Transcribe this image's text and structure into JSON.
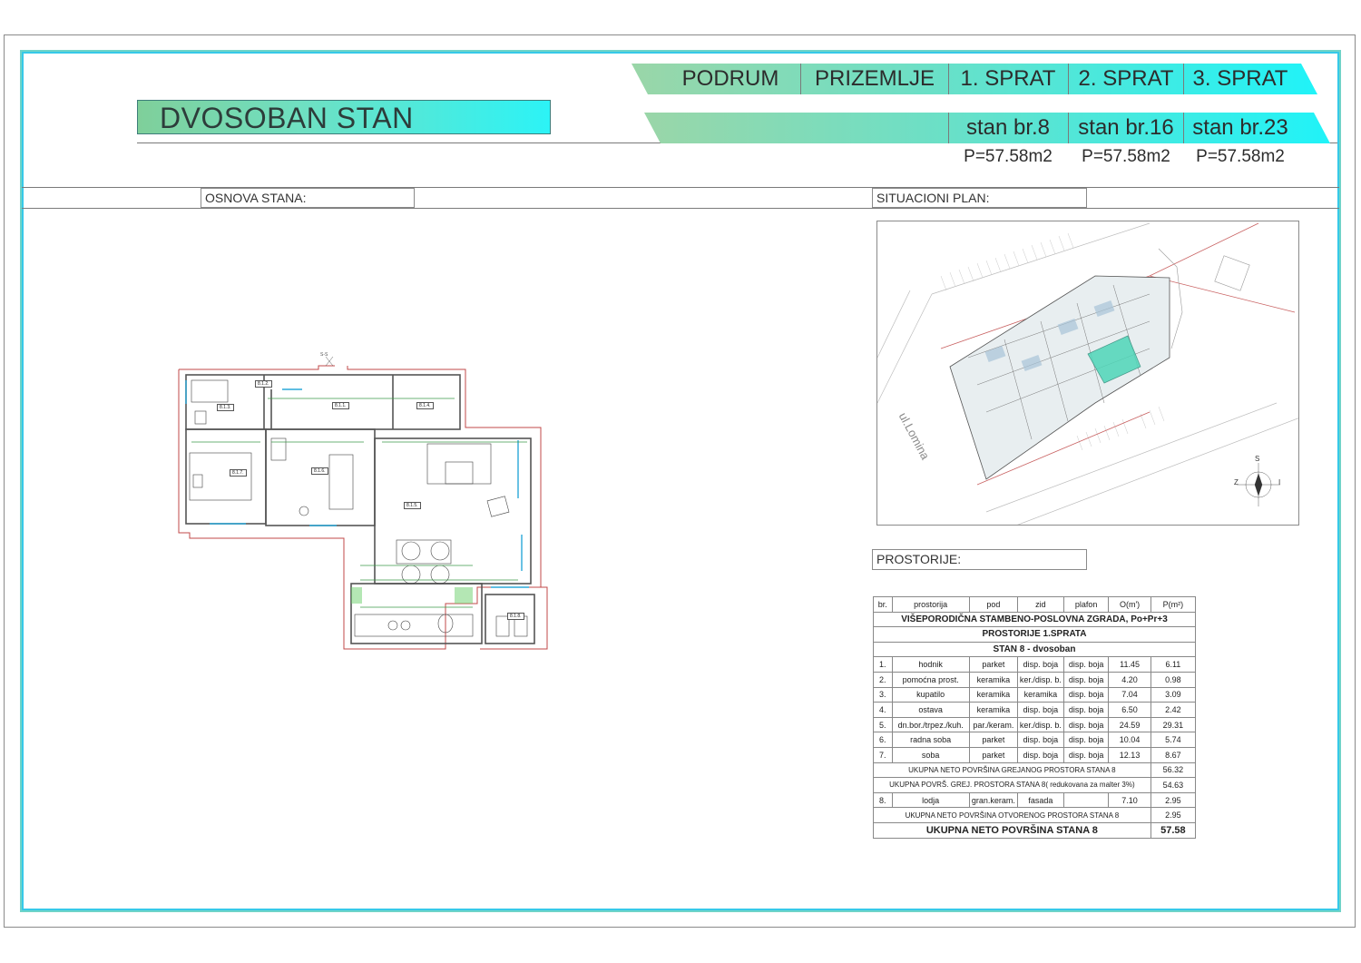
{
  "title": "DVOSOBAN STAN",
  "floors": [
    "PODRUM",
    "PRIZEMLJE",
    "1. SPRAT",
    "2. SPRAT",
    "3. SPRAT"
  ],
  "flats": [
    {
      "name": "stan br.8",
      "area": "P=57.58m2"
    },
    {
      "name": "stan br.16",
      "area": "P=57.58m2"
    },
    {
      "name": "stan br.23",
      "area": "P=57.58m2"
    }
  ],
  "sections": {
    "osnova": "OSNOVA STANA:",
    "situacioni": "SITUACIONI PLAN:",
    "prostorije": "PROSTORIJE:"
  },
  "colors": {
    "accent_cyan": "#2cf3f6",
    "accent_green": "#7fcf9a",
    "apartment_highlight": "#4fd6b8",
    "frame": "#6fd3c8"
  },
  "site_plan": {
    "street": "ul.Lomina",
    "compass": {
      "north": "S",
      "west": "Z",
      "east": "I"
    }
  },
  "floor_plan": {
    "rooms": [
      "8.1.1.",
      "8.1.2.",
      "8.1.3.",
      "8.1.4.",
      "8.1.5.",
      "8.1.6.",
      "8.1.7.",
      "8.1.8."
    ],
    "section_mark": "S-S"
  },
  "table": {
    "headers": [
      "br.",
      "prostorija",
      "pod",
      "zid",
      "plafon",
      "O(m')",
      "P(m²)"
    ],
    "building": "VIŠEPORODIČNA STAMBENO-POSLOVNA ZGRADA, Po+Pr+3",
    "floor": "PROSTORIJE 1.SPRATA",
    "unit": "STAN 8 - dvosoban",
    "rows": [
      {
        "br": "1.",
        "name": "hodnik",
        "pod": "parket",
        "zid": "disp. boja",
        "plafon": "disp. boja",
        "o": "11.45",
        "p": "6.11"
      },
      {
        "br": "2.",
        "name": "pomoćna prost.",
        "pod": "keramika",
        "zid": "ker./disp. b.",
        "plafon": "disp. boja",
        "o": "4.20",
        "p": "0.98"
      },
      {
        "br": "3.",
        "name": "kupatilo",
        "pod": "keramika",
        "zid": "keramika",
        "plafon": "disp. boja",
        "o": "7.04",
        "p": "3.09"
      },
      {
        "br": "4.",
        "name": "ostava",
        "pod": "keramika",
        "zid": "disp. boja",
        "plafon": "disp. boja",
        "o": "6.50",
        "p": "2.42"
      },
      {
        "br": "5.",
        "name": "dn.bor./trpez./kuh.",
        "pod": "par./keram.",
        "zid": "ker./disp. b.",
        "plafon": "disp. boja",
        "o": "24.59",
        "p": "29.31"
      },
      {
        "br": "6.",
        "name": "radna soba",
        "pod": "parket",
        "zid": "disp. boja",
        "plafon": "disp. boja",
        "o": "10.04",
        "p": "5.74"
      },
      {
        "br": "7.",
        "name": "soba",
        "pod": "parket",
        "zid": "disp. boja",
        "plafon": "disp. boja",
        "o": "12.13",
        "p": "8.67"
      }
    ],
    "subtotal_heated_label": "UKUPNA NETO POVRŠINA GREJANOG PROSTORA STANA 8",
    "subtotal_heated": "56.32",
    "subtotal_reduced_label": "UKUPNA  POVRŠ.  GREJ. PROSTORA STANA 8( redukovana za malter 3%)",
    "subtotal_reduced": "54.63",
    "loggia": {
      "br": "8.",
      "name": "lodja",
      "pod": "gran.keram.",
      "zid": "fasada",
      "plafon": "",
      "o": "7.10",
      "p": "2.95"
    },
    "subtotal_open_label": "UKUPNA NETO POVRŠINA OTVORENOG PROSTORA STANA 8",
    "subtotal_open": "2.95",
    "total_label": "UKUPNA NETO POVRŠINA STANA 8",
    "total": "57.58"
  }
}
